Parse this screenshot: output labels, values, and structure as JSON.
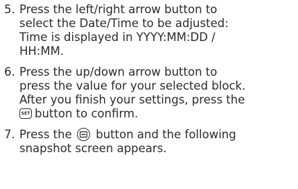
{
  "steps": [
    {
      "number": "5.",
      "lines": [
        "Press the left/right arrow button to",
        "select the Date/Time to be adjusted:",
        "Time is displayed in YYYY:MM:DD /",
        "HH:MM."
      ]
    },
    {
      "number": "6.",
      "lines": [
        "Press the up/down arrow button to",
        "press the value for your selected block.",
        "After you finish your settings, press the",
        "button to confirm."
      ],
      "icon_text": "SET"
    },
    {
      "number": "7.",
      "line1_before": "Press the",
      "line1_after": "button and the following",
      "line2": "snapshot screen appears."
    }
  ],
  "icons": {
    "set": "set-button-icon",
    "menu": "menu-button-icon"
  }
}
